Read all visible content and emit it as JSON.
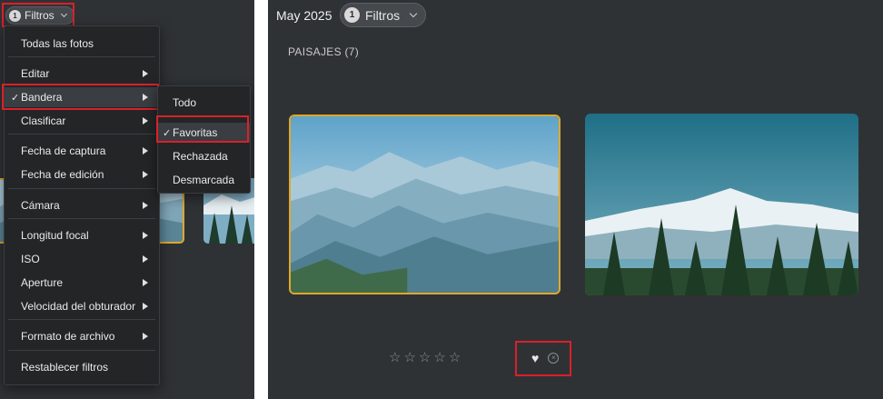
{
  "left": {
    "filter_chip": {
      "count": "1",
      "label": "Filtros"
    },
    "main_menu": {
      "items": [
        {
          "label": "Todas las fotos",
          "has_submenu": false,
          "checked": false
        },
        {
          "label": "Editar",
          "has_submenu": true,
          "checked": false
        },
        {
          "label": "Bandera",
          "has_submenu": true,
          "checked": true
        },
        {
          "label": "Clasificar",
          "has_submenu": true,
          "checked": false
        },
        {
          "label": "Fecha de captura",
          "has_submenu": true,
          "checked": false
        },
        {
          "label": "Fecha de edición",
          "has_submenu": true,
          "checked": false
        },
        {
          "label": "Cámara",
          "has_submenu": true,
          "checked": false
        },
        {
          "label": "Longitud focal",
          "has_submenu": true,
          "checked": false
        },
        {
          "label": "ISO",
          "has_submenu": true,
          "checked": false
        },
        {
          "label": "Aperture",
          "has_submenu": true,
          "checked": false
        },
        {
          "label": "Velocidad del obturador",
          "has_submenu": true,
          "checked": false
        },
        {
          "label": "Formato de archivo",
          "has_submenu": true,
          "checked": false
        },
        {
          "label": "Restablecer filtros",
          "has_submenu": false,
          "checked": false
        }
      ],
      "check_mark": "✓"
    },
    "sub_menu": {
      "items": [
        {
          "label": "Todo",
          "checked": false
        },
        {
          "label": "Favoritas",
          "checked": true
        },
        {
          "label": "Rechazada",
          "checked": false
        },
        {
          "label": "Desmarcada",
          "checked": false
        }
      ],
      "check_mark": "✓"
    }
  },
  "right": {
    "date_title": "May 2025",
    "filter_chip": {
      "count": "1",
      "label": "Filtros"
    },
    "section_label": "PAISAJES (7)",
    "rating_stars": [
      "☆",
      "☆",
      "☆",
      "☆",
      "☆"
    ],
    "favorite_icon": "♥",
    "reject_icon": "×"
  },
  "colors": {
    "panel_bg": "#2f3235",
    "menu_bg": "#232527",
    "highlight": "#d9202a",
    "selected_border": "#e0a72a"
  }
}
